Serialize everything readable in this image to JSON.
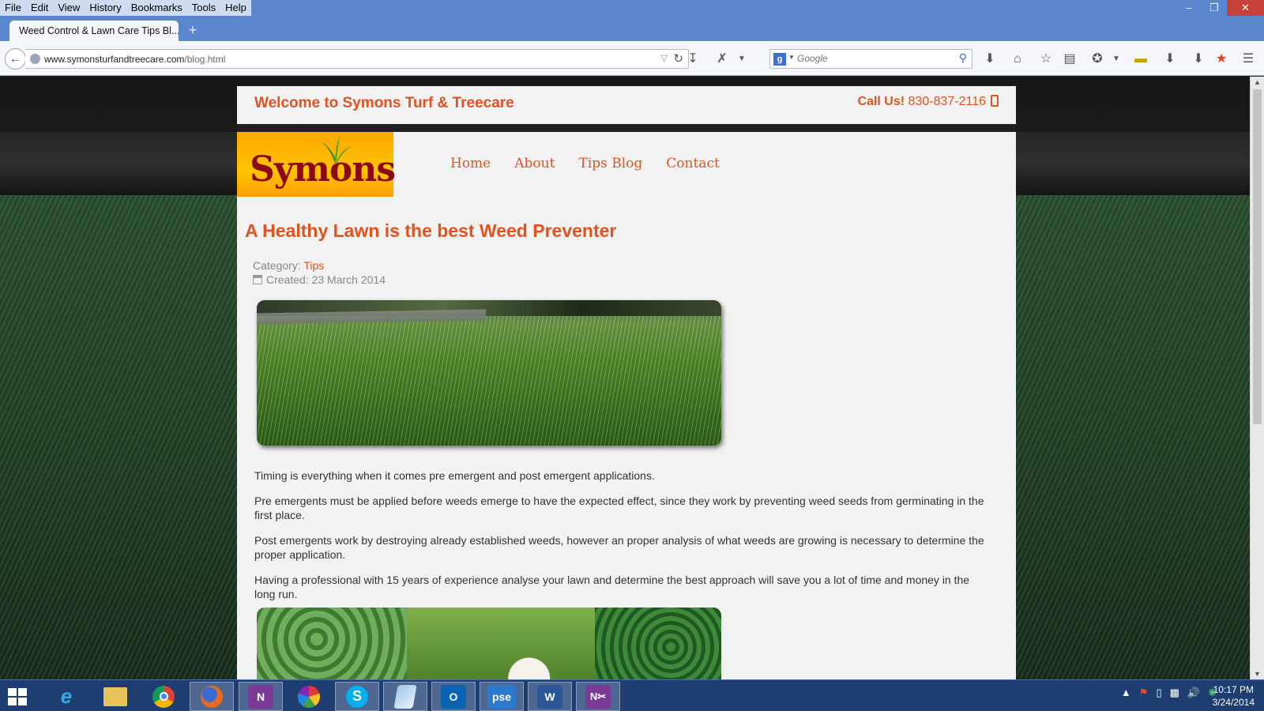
{
  "browser": {
    "menu": [
      "File",
      "Edit",
      "View",
      "History",
      "Bookmarks",
      "Tools",
      "Help"
    ],
    "tab_title": "Weed Control & Lawn Care Tips Bl...",
    "url_host": "www.symonsturfandtreecare.com",
    "url_path": "/blog.html",
    "search_engine_label": "g",
    "search_placeholder": "Google",
    "window_controls": {
      "minimize": "–",
      "restore": "❐",
      "close": "✕"
    }
  },
  "site": {
    "welcome": "Welcome to Symons Turf & Treecare",
    "call_label": "Call Us!",
    "phone": "830-837-2116",
    "logo_text": "Symons",
    "nav": [
      "Home",
      "About",
      "Tips Blog",
      "Contact"
    ]
  },
  "post": {
    "title": "A Healthy Lawn is the best Weed Preventer",
    "category_label": "Category:",
    "category": "Tips",
    "created": "Created: 23 March 2014",
    "paragraphs": [
      "Timing is everything when it comes pre emergent and post emergent applications.",
      "Pre emergents must be applied before weeds emerge to have the expected effect, since they work by preventing weed seeds from germinating in the first place.",
      "Post emergents work by destroying already established weeds, however an proper analysis of what weeds are growing is necessary to determine the proper application.",
      "Having a professional with 15 years of experience analyse your lawn and determine the best approach will save you a lot of time and money in the long run."
    ]
  },
  "taskbar": {
    "apps": [
      "internet-explorer",
      "file-explorer",
      "chrome",
      "firefox",
      "onenote",
      "picasa",
      "skype",
      "notes",
      "outlook",
      "pse",
      "word",
      "onenote-clip"
    ],
    "labels": {
      "pse": "pse",
      "word": "W",
      "outlook": "O",
      "onenote": "N",
      "skype": "S"
    },
    "time": "10:17 PM",
    "date": "3/24/2014"
  },
  "colors": {
    "accent": "#e0531f",
    "taskbar": "#1e3e72",
    "titlebar": "#5b87cf"
  }
}
